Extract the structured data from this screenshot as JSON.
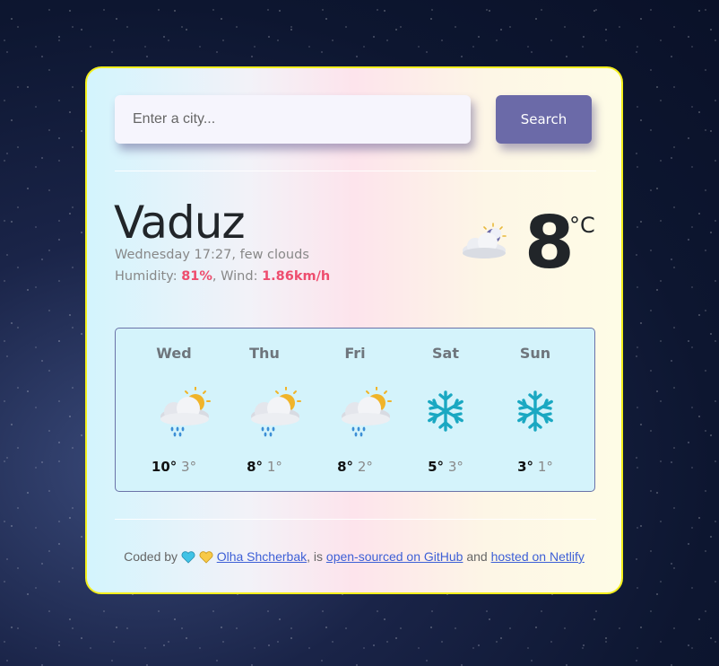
{
  "search": {
    "placeholder": "Enter a city...",
    "button_label": "Search"
  },
  "current": {
    "city": "Vaduz",
    "description": "Wednesday 17:27, few clouds",
    "humidity_label": "Humidity: ",
    "humidity_value": "81%",
    "wind_label": ", Wind: ",
    "wind_value": "1.86km/h",
    "temperature": "8",
    "unit": "°C",
    "icon": "night-few-clouds-icon"
  },
  "forecast": [
    {
      "day": "Wed",
      "max": "10°",
      "min": "3°",
      "icon": "sun-rain-cloud-icon"
    },
    {
      "day": "Thu",
      "max": "8°",
      "min": "1°",
      "icon": "sun-rain-cloud-icon"
    },
    {
      "day": "Fri",
      "max": "8°",
      "min": "2°",
      "icon": "sun-rain-cloud-icon"
    },
    {
      "day": "Sat",
      "max": "5°",
      "min": "3°",
      "icon": "snowflake-icon"
    },
    {
      "day": "Sun",
      "max": "3°",
      "min": "1°",
      "icon": "snowflake-icon"
    }
  ],
  "footer": {
    "prefix": "Coded by ",
    "author": "Olha Shcherbak",
    "sep1": ", is ",
    "github": "open-sourced on GitHub",
    "sep2": " and ",
    "netlify": "hosted on Netlify"
  },
  "colors": {
    "accent": "#6b6aa8",
    "highlight": "#ee4d6e",
    "card_border": "#f4ef1c",
    "link": "#3d5fd6"
  }
}
